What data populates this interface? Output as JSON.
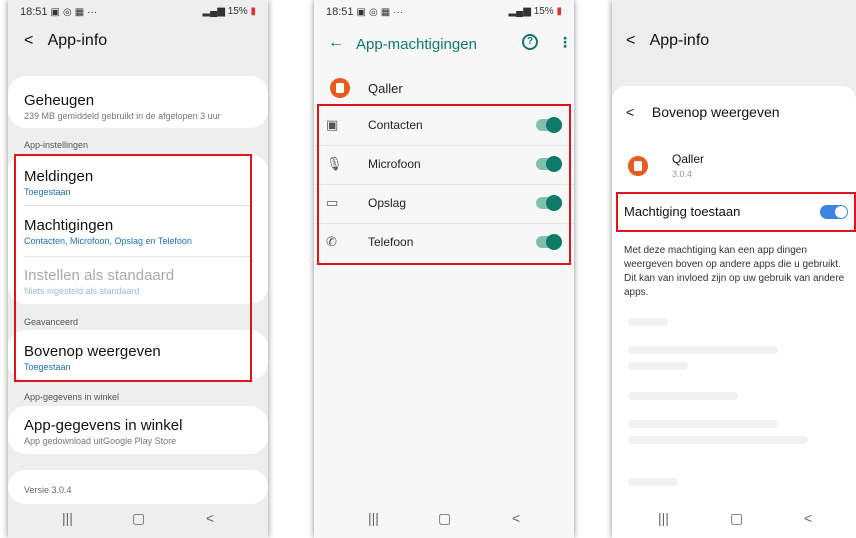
{
  "status": {
    "time": "18:51",
    "battery": "15%"
  },
  "screen1": {
    "title": "App-info",
    "storage": {
      "label": "Geheugen",
      "sub": "239 MB gemiddeld gebruikt in de afgelopen 3 uur"
    },
    "section_app_settings": "App-instellingen",
    "notifications": {
      "label": "Meldingen",
      "sub": "Toegestaan"
    },
    "permissions": {
      "label": "Machtigingen",
      "sub": "Contacten, Microfoon, Opslag en Telefoon"
    },
    "default": {
      "label": "Instellen als standaard",
      "sub": "Niets ingesteld als standaard"
    },
    "section_advanced": "Geavanceerd",
    "overlay": {
      "label": "Bovenop weergeven",
      "sub": "Toegestaan"
    },
    "section_store": "App-gegevens in winkel",
    "store": {
      "label": "App-gegevens in winkel",
      "sub": "App gedownload uitGoogle Play Store"
    },
    "version": "Versie 3.0.4"
  },
  "screen2": {
    "title": "App-machtigingen",
    "app_name": "Qaller",
    "permissions": [
      {
        "label": "Contacten",
        "icon": "contacts-icon",
        "enabled": true
      },
      {
        "label": "Microfoon",
        "icon": "microphone-icon",
        "enabled": true
      },
      {
        "label": "Opslag",
        "icon": "folder-icon",
        "enabled": true
      },
      {
        "label": "Telefoon",
        "icon": "phone-icon",
        "enabled": true
      }
    ]
  },
  "screen3": {
    "title": "App-info",
    "dialog_title": "Bovenop weergeven",
    "app_name": "Qaller",
    "app_version": "3.0.4",
    "allow_label": "Machtiging toestaan",
    "allow_enabled": true,
    "description": "Met deze machtiging kan een app dingen weergeven boven op andere apps die u gebruikt. Dit kan van invloed zijn op uw gebruik van andere apps."
  },
  "colors": {
    "highlight": "#e0141c",
    "teal": "#0f7a68",
    "blue_link": "#1e6fb8",
    "toggle_blue": "#3b86e0",
    "app_icon": "#e85a1e"
  }
}
